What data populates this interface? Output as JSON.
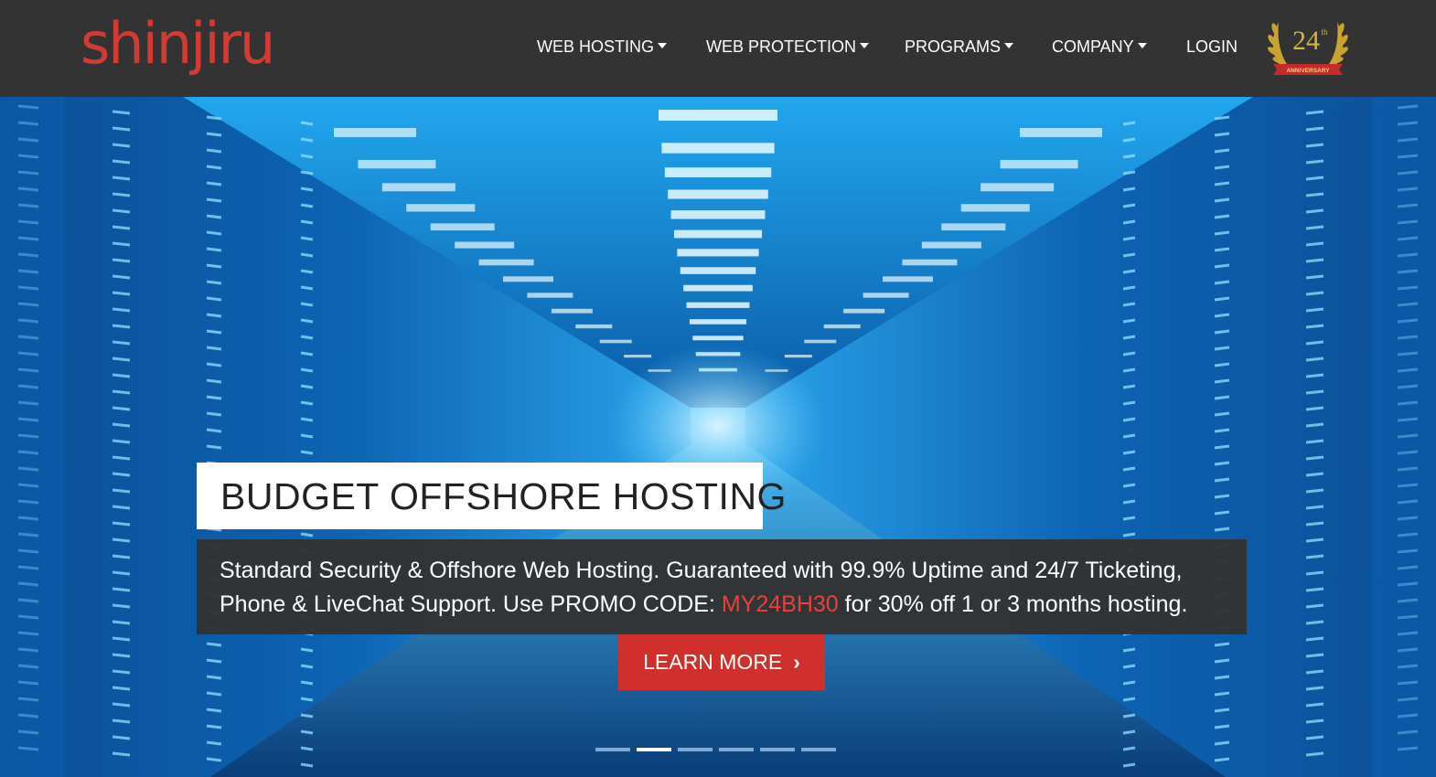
{
  "brand": {
    "logo_text": "shinjiru",
    "logo_color": "#d33a34"
  },
  "nav": {
    "items": [
      {
        "label": "WEB HOSTING",
        "has_dropdown": true
      },
      {
        "label": "WEB PROTECTION",
        "has_dropdown": true
      },
      {
        "label": "PROGRAMS",
        "has_dropdown": true
      },
      {
        "label": "COMPANY",
        "has_dropdown": true
      },
      {
        "label": "LOGIN",
        "has_dropdown": false
      }
    ]
  },
  "badge": {
    "number": "24",
    "suffix": "th",
    "ribbon_text": "ANNIVERSARY"
  },
  "hero": {
    "title": "BUDGET OFFSHORE HOSTING",
    "description_part1": "Standard Security & Offshore Web Hosting. Guaranteed with 99.9% Uptime and 24/7 Ticketing, Phone & LiveChat Support. Use PROMO CODE: ",
    "promo_code": "MY24BH30",
    "description_part2": " for 30% off 1 or 3 months hosting.",
    "cta_label": "LEARN MORE",
    "promo_color": "#e8413b",
    "cta_color": "#d0302c"
  },
  "carousel": {
    "slide_count": 6,
    "active_index": 1
  }
}
